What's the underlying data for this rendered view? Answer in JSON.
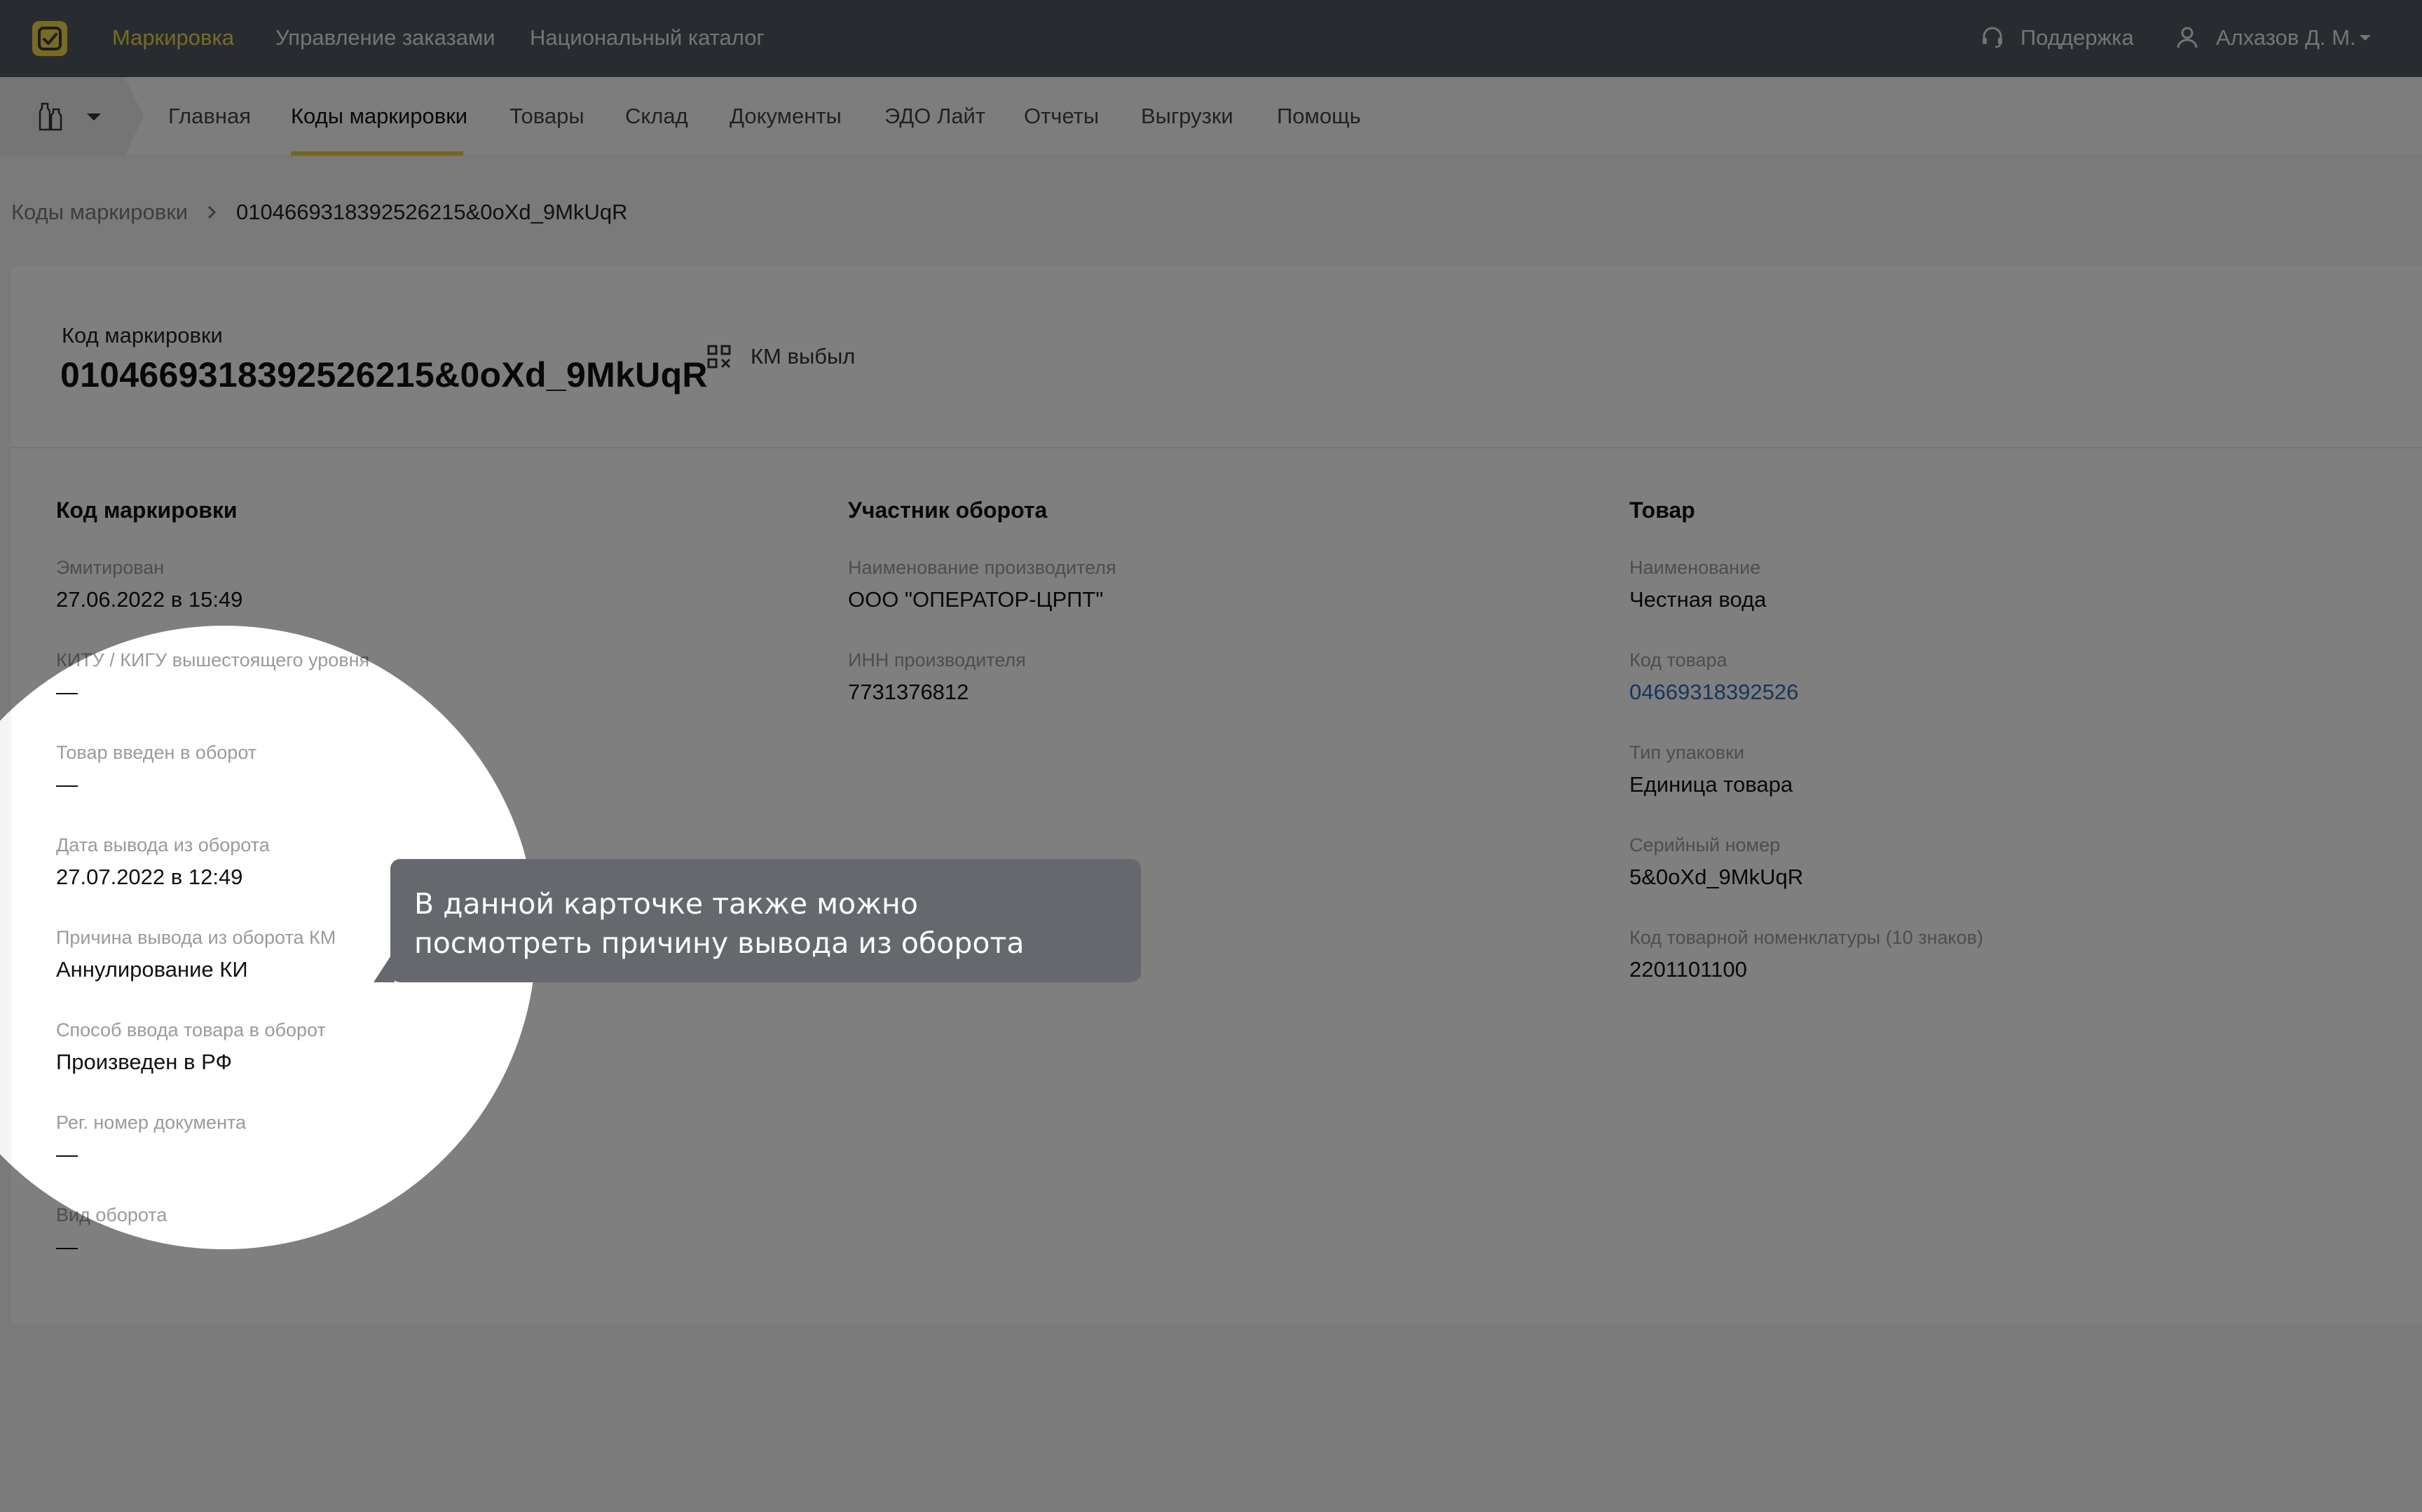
{
  "topbar": {
    "nav": [
      "Маркировка",
      "Управление заказами",
      "Национальный каталог"
    ],
    "support": "Поддержка",
    "user": "Алхазов Д. М."
  },
  "subnav": {
    "items": [
      "Главная",
      "Коды маркировки",
      "Товары",
      "Склад",
      "Документы",
      "ЭДО Лайт",
      "Отчеты",
      "Выгрузки",
      "Помощь"
    ],
    "active": "Коды маркировки"
  },
  "breadcrumb": {
    "parent": "Коды маркировки",
    "current": "0104669318392526215&0oXd_9MkUqR"
  },
  "header": {
    "caption": "Код маркировки",
    "code": "0104669318392526215&0oXd_9MkUqR",
    "status": "КМ выбыл"
  },
  "sections": [
    {
      "title": "Код маркировки",
      "fields": [
        {
          "label": "Эмитирован",
          "value": "27.06.2022 в 15:49"
        },
        {
          "label": "КИТУ / КИГУ вышестоящего уровня",
          "value": "—"
        },
        {
          "label": "Товар введен в оборот",
          "value": "—"
        },
        {
          "label": "Дата вывода из оборота",
          "value": "27.07.2022 в 12:49"
        },
        {
          "label": "Причина вывода из оборота КМ",
          "value": "Аннулирование КИ"
        },
        {
          "label": "Способ ввода товара в оборот",
          "value": "Произведен в РФ"
        },
        {
          "label": "Рег. номер документа",
          "value": "—"
        },
        {
          "label": "Вид оборота",
          "value": "—"
        }
      ]
    },
    {
      "title": "Участник оборота",
      "fields": [
        {
          "label": "Наименование производителя",
          "value": "ООО \"ОПЕРАТОР-ЦРПТ\""
        },
        {
          "label": "ИНН производителя",
          "value": "7731376812"
        }
      ]
    },
    {
      "title": "Товар",
      "fields": [
        {
          "label": "Наименование",
          "value": "Честная вода"
        },
        {
          "label": "Код товара",
          "value": "04669318392526"
        },
        {
          "label": "Тип упаковки",
          "value": "Единица товара"
        },
        {
          "label": "Серийный номер",
          "value": "5&0oXd_9MkUqR"
        },
        {
          "label": "Код товарной номенклатуры (10 знаков)",
          "value": "2201101100"
        }
      ]
    }
  ],
  "tooltip": {
    "line1": "В данной карточке также можно",
    "line2": "посмотреть причину вывода из оборота"
  },
  "colors": {
    "topbar": "#515861",
    "accent": "#e6cf3a",
    "link": "#2f6db5",
    "tooltip": "#65696e",
    "overlay": "rgba(0,0,0,0.5)"
  }
}
